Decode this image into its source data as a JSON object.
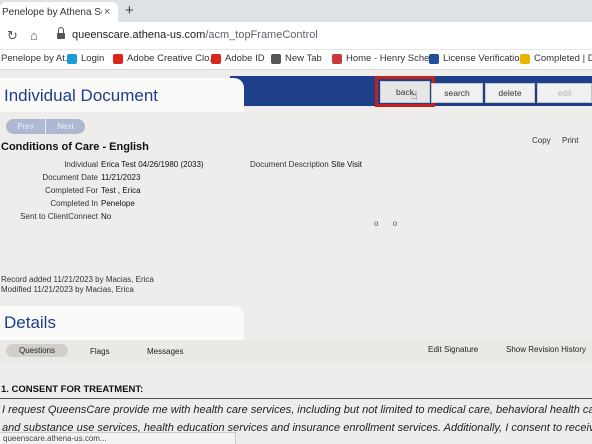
{
  "browser": {
    "tab_title": "Penelope by Athena Softwa",
    "tab_close": "×",
    "new_tab": "+",
    "url_host": "queenscare.athena-us.com",
    "url_path": "/acm_topFrameControl",
    "status_url": "queenscare.athena-us.com...",
    "bookmarks": [
      {
        "label": "Penelope by At...",
        "icon": "penelope-icon",
        "color": "#ffffff"
      },
      {
        "label": "Login",
        "icon": "salesforce-icon",
        "color": "#1a9bd7"
      },
      {
        "label": "Adobe Creative Clo...",
        "icon": "adobe-icon",
        "color": "#d8261c"
      },
      {
        "label": "Adobe ID",
        "icon": "adobe-icon",
        "color": "#d8261c"
      },
      {
        "label": "New Tab",
        "icon": "globe-icon",
        "color": "#555555"
      },
      {
        "label": "Home - Henry Sche...",
        "icon": "henry-schein-icon",
        "color": "#c83a3a"
      },
      {
        "label": "License Verification",
        "icon": "license-icon",
        "color": "#1e4f9c"
      },
      {
        "label": "Completed | Do",
        "icon": "download-icon",
        "color": "#e8b600"
      }
    ]
  },
  "app": {
    "page_title": "Individual Document",
    "actions": {
      "back": "back",
      "search": "search",
      "delete": "delete",
      "edit": "edit"
    },
    "prev": "Prev",
    "next": "Next",
    "document_name": "Conditions of Care - English",
    "copy": "Copy",
    "print": "Print",
    "fields": {
      "individual_label": "Individual",
      "individual_value": "Erica  Test  04/26/1980 (2033)",
      "document_date_label": "Document Date",
      "document_date_value": "11/21/2023",
      "completed_for_label": "Completed For",
      "completed_for_value": "Test , Erica",
      "completed_in_label": "Completed In",
      "completed_in_value": "Penelope",
      "sent_label": "Sent to ClientConnect",
      "sent_value": "No",
      "description_label": "Document Description",
      "description_value": "Site Visit"
    },
    "dots": "o o",
    "record_added": "Record added 11/21/2023 by Macias, Erica",
    "modified": "Modified 11/21/2023 by Macias, Erica",
    "details_title": "Details",
    "subtabs": {
      "questions": "Questions",
      "flags": "Flags",
      "messages": "Messages"
    },
    "edit_signature": "Edit Signature",
    "show_revision_history": "Show Revision History",
    "consent_heading": "1. CONSENT FOR TREATMENT:",
    "consent_line1": "I request QueensCare provide me with health care services, including but not limited to medical care, behavioral health care,",
    "consent_line2": "and substance use services, health education services and insurance enrollment services. Additionally, I consent to receiving"
  },
  "colors": {
    "brand_blue": "#1e3f8a",
    "highlight_red": "#c0231e",
    "pill_blue": "#aeb8d3"
  }
}
